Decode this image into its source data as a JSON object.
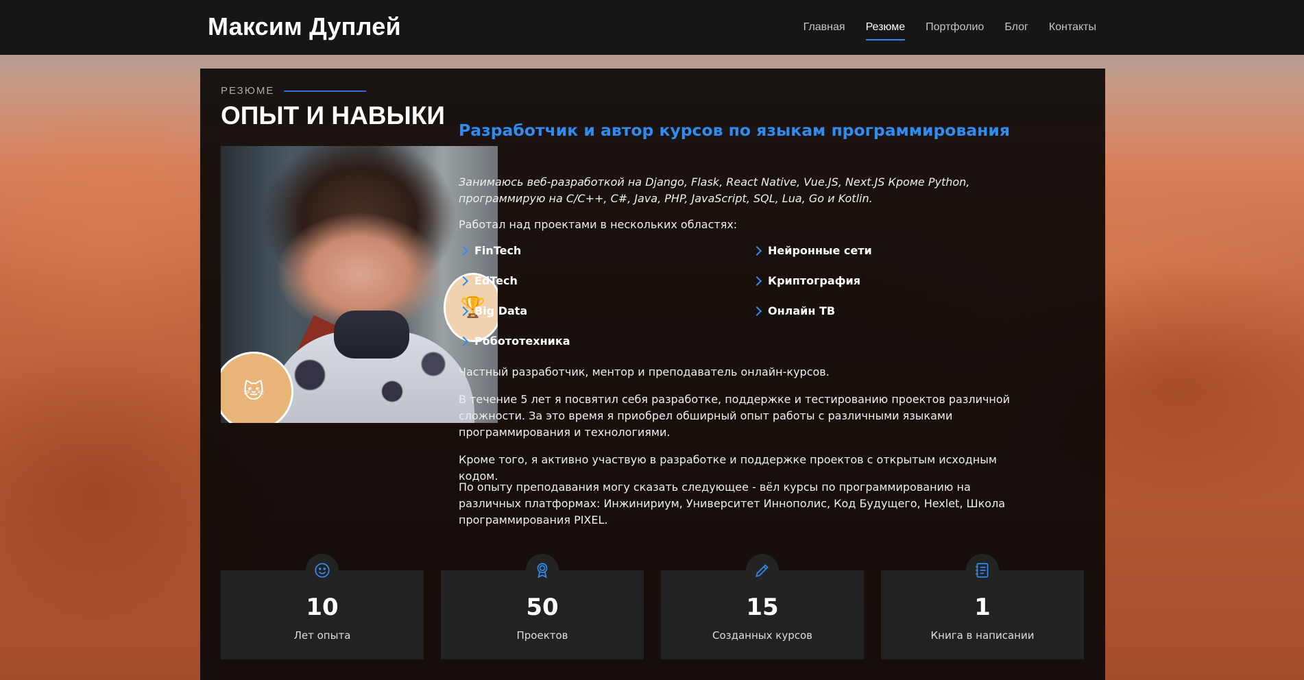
{
  "header": {
    "logo": "Максим Дуплей",
    "nav": [
      {
        "label": "Главная",
        "active": false
      },
      {
        "label": "Резюме",
        "active": true
      },
      {
        "label": "Портфолио",
        "active": false
      },
      {
        "label": "Блог",
        "active": false
      },
      {
        "label": "Контакты",
        "active": false
      }
    ]
  },
  "section": {
    "label": "РЕЗЮМЕ",
    "title": "ОПЫТ И НАВЫКИ"
  },
  "profile": {
    "job_title": "Разработчик и автор курсов по языкам программирования",
    "subtitle": "Занимаюсь веб-разработкой на Django, Flask, React Native, Vue.JS, Next.JS Кроме Python, программирую на C/C++, C#, Java, PHP, JavaScript, SQL, Lua, Go и Kotlin.",
    "areas_intro": "Работал над проектами в нескольких областях:",
    "areas": [
      "FinTech",
      "EdTech",
      "Big Data",
      "Робототехника",
      "Нейронные сети",
      "Криптография",
      "Онлайн ТВ"
    ],
    "paragraphs": [
      "Частный разработчик, ментор и преподаватель онлайн-курсов.",
      "В течение 5 лет я посвятил себя разработке, поддержке и тестированию проектов различной сложности. За это время я приобрел обширный опыт работы с различными языками программирования и технологиями.",
      "Кроме того, я активно участвую в разработке и поддержке проектов с открытым исходным кодом.",
      "По опыту преподавания могу сказать следующее - вёл курсы по программированию на различных платформах: Инжинириум, Университет Иннополис, Код Будущего, Hexlet, Школа программирования PIXEL."
    ]
  },
  "stats": [
    {
      "icon": "smile-icon",
      "value": "10",
      "label": "Лет опыта"
    },
    {
      "icon": "award-icon",
      "value": "50",
      "label": "Проектов"
    },
    {
      "icon": "pencil-icon",
      "value": "15",
      "label": "Созданных курсов"
    },
    {
      "icon": "journal-icon",
      "value": "1",
      "label": "Книга в написании"
    }
  ],
  "colors": {
    "accent": "#2f8cf2",
    "header_bg": "#141617",
    "card_bg": "#0a0908",
    "stat_bg": "#222222"
  }
}
